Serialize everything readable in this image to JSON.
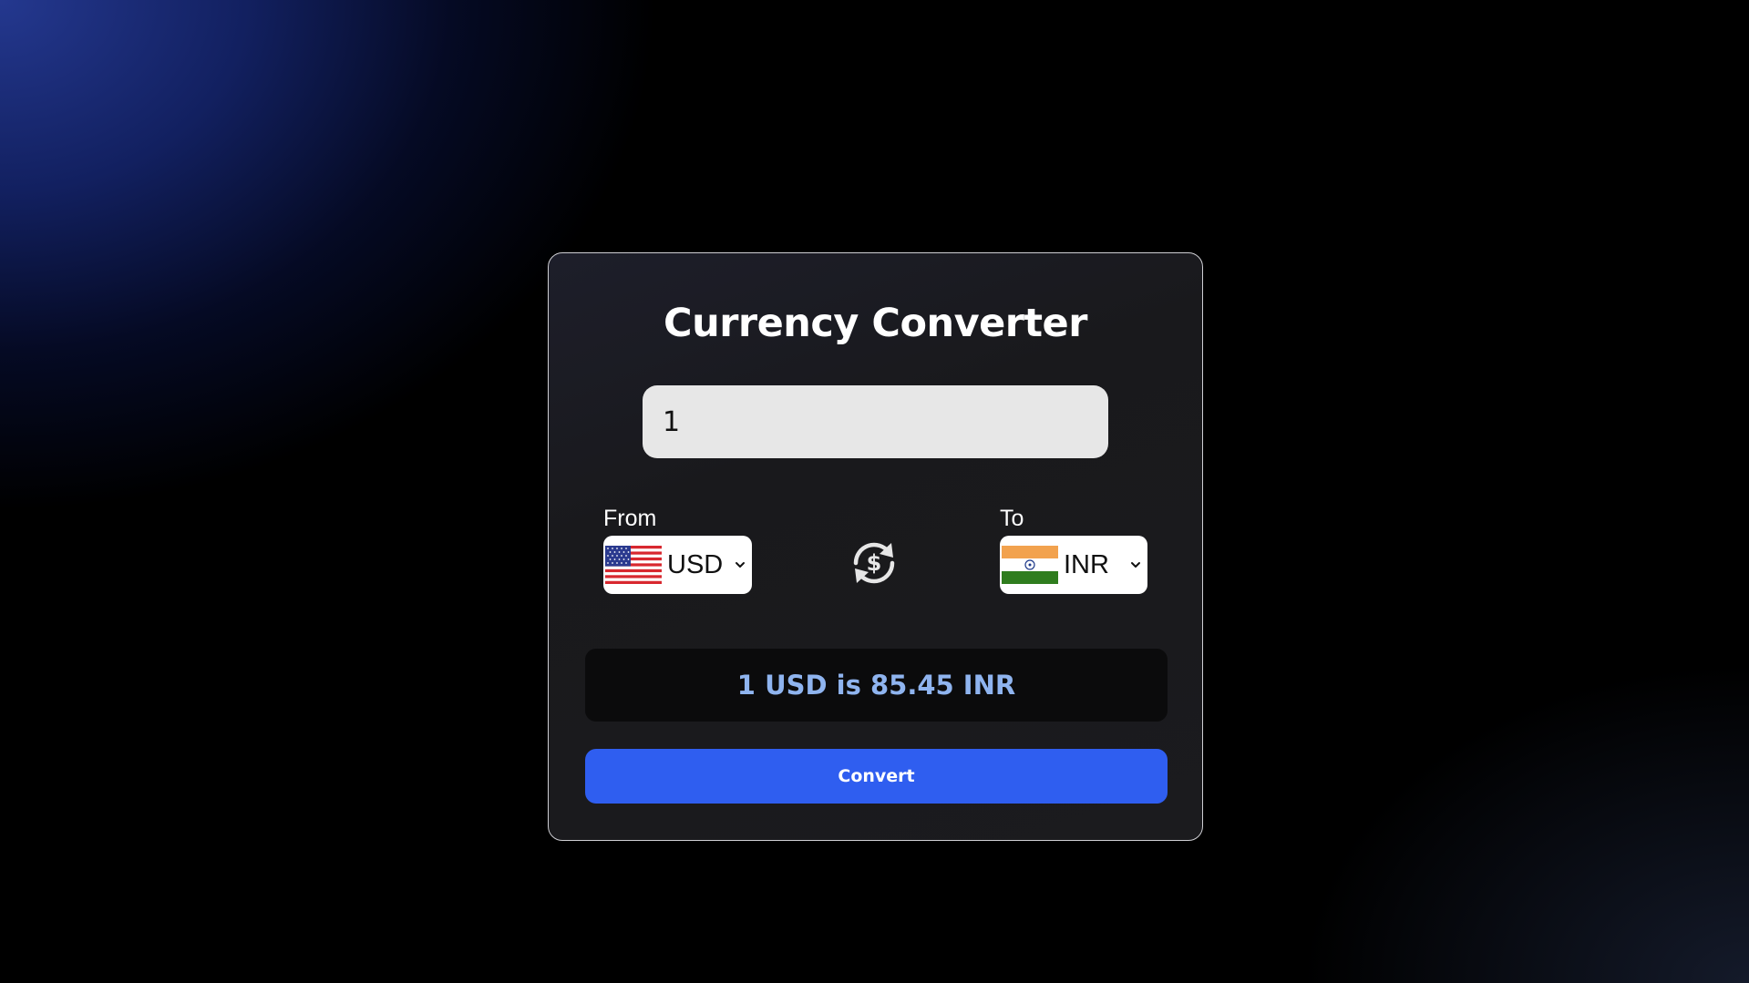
{
  "app": {
    "title": "Currency Converter"
  },
  "amount": {
    "value": "1"
  },
  "from": {
    "label": "From",
    "currency": "USD",
    "flag_icon": "us-flag-icon"
  },
  "to": {
    "label": "To",
    "currency": "INR",
    "flag_icon": "india-flag-icon"
  },
  "swap": {
    "icon": "currency-exchange-icon"
  },
  "result": {
    "text": "1 USD is 85.45 INR"
  },
  "convert": {
    "label": "Convert"
  },
  "colors": {
    "accent": "#2f5ef0",
    "result_text": "#8fb4ef",
    "card_background": "#1b1b1e",
    "input_background": "#e7e7e7"
  }
}
